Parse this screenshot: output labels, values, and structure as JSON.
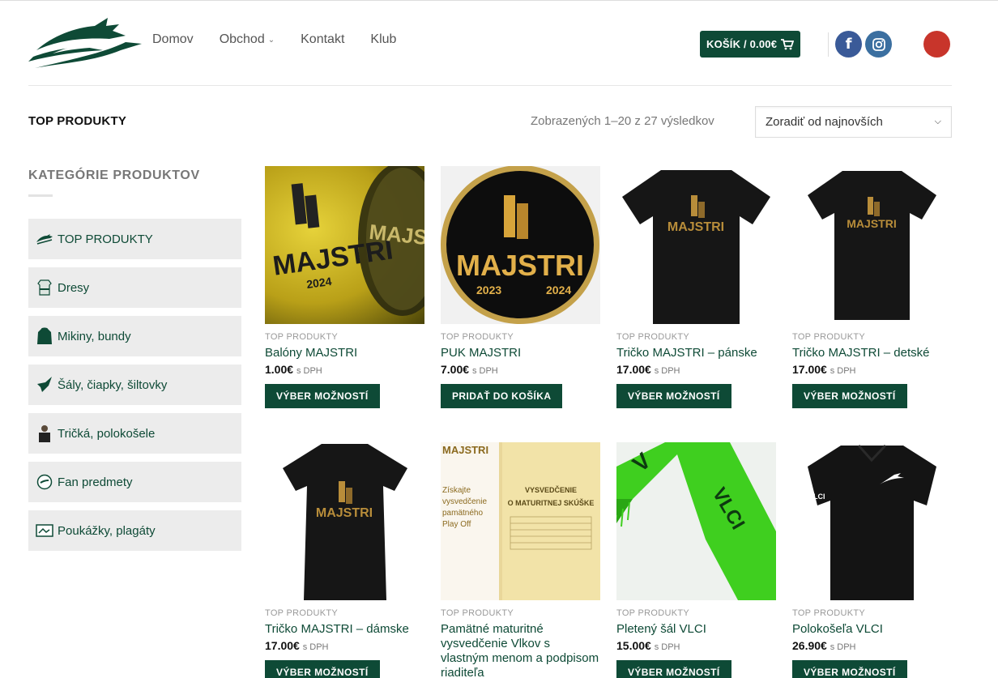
{
  "header": {
    "nav": [
      {
        "label": "Domov"
      },
      {
        "label": "Obchod"
      },
      {
        "label": "Kontakt"
      },
      {
        "label": "Klub"
      }
    ],
    "cart_label": "KOŠÍK / 0.00€"
  },
  "toolbar": {
    "page_title": "TOP PRODUKTY",
    "results": "Zobrazených 1–20 z 27 výsledkov",
    "sort_selected": "Zoradiť od najnovších"
  },
  "sidebar": {
    "title": "KATEGÓRIE PRODUKTOV",
    "items": [
      {
        "label": "TOP PRODUKTY"
      },
      {
        "label": "Dresy"
      },
      {
        "label": "Mikiny, bundy"
      },
      {
        "label": "Šály, čiapky, šiltovky"
      },
      {
        "label": "Tričká, polokošele"
      },
      {
        "label": "Fan predmety"
      },
      {
        "label": "Poukážky, plagáty"
      }
    ]
  },
  "products": [
    {
      "category": "TOP PRODUKTY",
      "name": "Balóny MAJSTRI",
      "price": "1.00€",
      "tax": "s DPH",
      "button": "VÝBER MOŽNOSTÍ"
    },
    {
      "category": "TOP PRODUKTY",
      "name": "PUK MAJSTRI",
      "price": "7.00€",
      "tax": "s DPH",
      "button": "PRIDAŤ DO KOŠÍKA"
    },
    {
      "category": "TOP PRODUKTY",
      "name": "Tričko MAJSTRI – pánske",
      "price": "17.00€",
      "tax": "s DPH",
      "button": "VÝBER MOŽNOSTÍ"
    },
    {
      "category": "TOP PRODUKTY",
      "name": "Tričko MAJSTRI – detské",
      "price": "17.00€",
      "tax": "s DPH",
      "button": "VÝBER MOŽNOSTÍ"
    },
    {
      "category": "TOP PRODUKTY",
      "name": "Tričko MAJSTRI – dámske",
      "price": "17.00€",
      "tax": "s DPH",
      "button": "VÝBER MOŽNOSTÍ"
    },
    {
      "category": "TOP PRODUKTY",
      "name": "Pamätné maturitné vysvedčenie Vlkov s vlastným menom a podpisom riaditeľa",
      "price": "",
      "tax": "",
      "button": ""
    },
    {
      "category": "TOP PRODUKTY",
      "name": "Pletený šál VLCI",
      "price": "15.00€",
      "tax": "s DPH",
      "button": "VÝBER MOŽNOSTÍ"
    },
    {
      "category": "TOP PRODUKTY",
      "name": "Polokošeľa VLCI",
      "price": "26.90€",
      "tax": "s DPH",
      "button": "VÝBER MOŽNOSTÍ"
    }
  ],
  "image_text": {
    "majstri": "MAJSTRI",
    "year_a": "2023",
    "year_b": "2024",
    "cert_title": "VYSVEDČENIE O MATURITNEJ SKÚŠKE",
    "cert_side": "Získajte vysvedčenie pamätného Play Off",
    "scarf": "VLCI"
  },
  "colors": {
    "brand": "#0e4a36",
    "facebook": "#3a5a98",
    "instagram": "#3b6fa0",
    "accent_red": "#c8352b"
  }
}
